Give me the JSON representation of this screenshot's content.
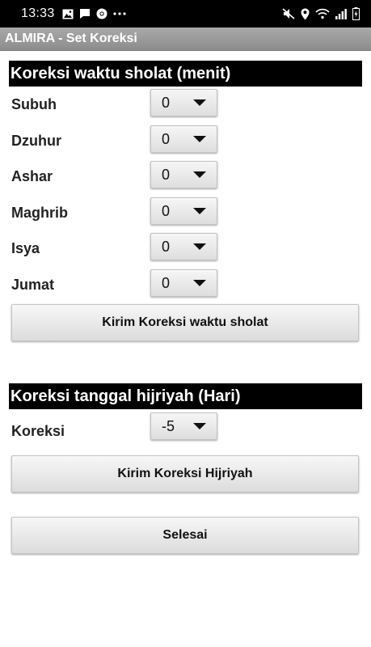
{
  "status_bar": {
    "time": "13:33",
    "left_icons": [
      "image-icon",
      "message-icon",
      "chrome-icon",
      "more-icon"
    ],
    "right_icons": [
      "mute-icon",
      "location-icon",
      "wifi-icon",
      "signal-icon",
      "battery-icon"
    ]
  },
  "app": {
    "title": "ALMIRA - Set Koreksi"
  },
  "prayer_section": {
    "title": "Koreksi waktu sholat (menit)",
    "rows": [
      {
        "label": "Subuh",
        "value": "0"
      },
      {
        "label": "Dzuhur",
        "value": "0"
      },
      {
        "label": "Ashar",
        "value": "0"
      },
      {
        "label": "Maghrib",
        "value": "0"
      },
      {
        "label": "Isya",
        "value": "0"
      },
      {
        "label": "Jumat",
        "value": "0"
      }
    ],
    "submit_label": "Kirim Koreksi waktu sholat"
  },
  "hijri_section": {
    "title": "Koreksi tanggal hijriyah (Hari)",
    "row": {
      "label": "Koreksi",
      "value": "-5"
    },
    "submit_label": "Kirim Koreksi Hijriyah"
  },
  "done_label": "Selesai"
}
